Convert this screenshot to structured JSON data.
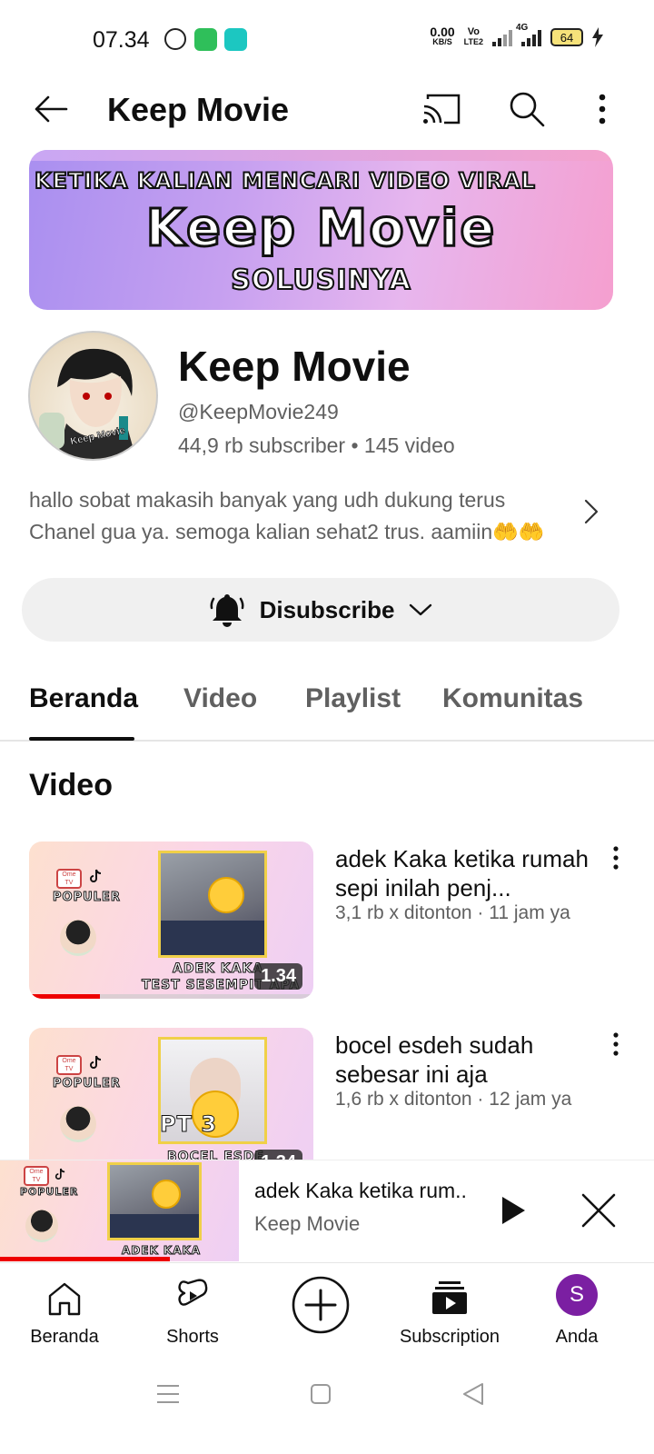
{
  "status_bar": {
    "time": "07.34",
    "net_speed_value": "0.00",
    "net_speed_unit": "KB/S",
    "volte_top": "Vo",
    "volte_bottom": "LTE2",
    "network_type": "4G",
    "battery": "64"
  },
  "app_bar": {
    "title": "Keep Movie"
  },
  "banner": {
    "line1": "KETIKA KALIAN MENCARI VIDEO VIRAL",
    "line2": "Keep Movie",
    "line3": "SOLUSINYA"
  },
  "channel": {
    "avatar_text": "Keep Movie",
    "name": "Keep Movie",
    "handle": "@KeepMovie249",
    "stats": "44,9 rb subscriber • 145 video",
    "description": "hallo sobat makasih banyak yang udh dukung terus Chanel gua ya. semoga kalian sehat2 trus. aamiin🤲🤲"
  },
  "subscribe": {
    "label": "Disubscribe"
  },
  "tabs": [
    {
      "label": "Beranda",
      "active": true
    },
    {
      "label": "Video",
      "active": false
    },
    {
      "label": "Playlist",
      "active": false
    },
    {
      "label": "Komunitas",
      "active": false
    }
  ],
  "section": {
    "title": "Video"
  },
  "videos": [
    {
      "title": "adek Kaka ketika rumah sepi inilah penj...",
      "meta": "3,1 rb x ditonton · 11 jam ya",
      "duration": "1.34",
      "thumb_caption_1": "ADEK KAKA",
      "thumb_caption_2": "TEST SESEMPIT APA",
      "thumb_brand": "POPULER",
      "progress": 0.25
    },
    {
      "title": "bocel esdeh sudah sebesar ini aja",
      "meta": "1,6 rb x ditonton · 12 jam ya",
      "duration": "1.34",
      "thumb_caption_1": "PT 3",
      "thumb_caption_2": "BOCEL ESDE",
      "thumb_brand": "POPULER",
      "progress": 0
    }
  ],
  "mini_player": {
    "title": "adek Kaka ketika rum..",
    "channel": "Keep Movie",
    "thumb_brand": "POPULER",
    "thumb_caption": "ADEK KAKA",
    "progress": 0.26
  },
  "bottom_nav": {
    "home": "Beranda",
    "shorts": "Shorts",
    "subscriptions": "Subscription",
    "you": "Anda",
    "avatar_letter": "S"
  },
  "colors": {
    "accent_red": "#ee0000",
    "avatar_purple": "#7b1fa2",
    "whatsapp_green": "#25d366",
    "icon_teal": "#1cc7c1"
  }
}
